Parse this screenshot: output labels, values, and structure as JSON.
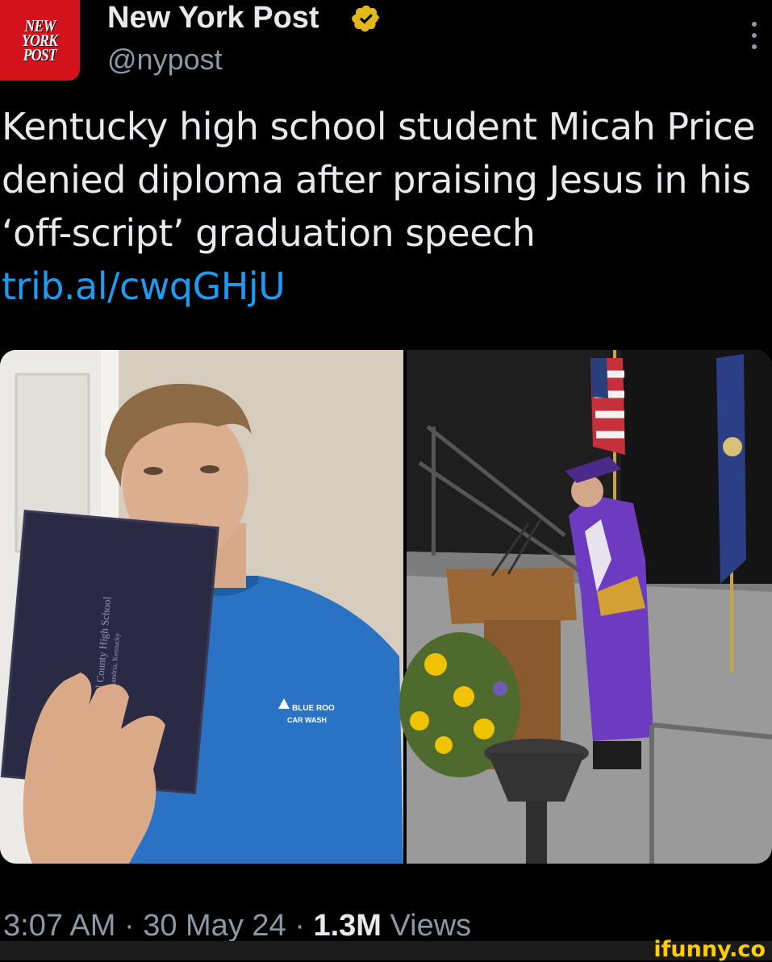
{
  "account": {
    "logo_lines": [
      "NEW",
      "YORK",
      "POST"
    ],
    "display_name": "New York Post",
    "handle": "@nypost",
    "badge_color": "#e2b719"
  },
  "tweet": {
    "text": "Kentucky high school student Micah Price denied diploma after praising Jesus in his ‘off-script’ graduation speech ",
    "link": "trib.al/cwqGHjU"
  },
  "media": {
    "diploma_lines": [
      "Al County High School",
      "Alexandria, Kentucky"
    ],
    "shirt_lines": [
      "BLUE ROO",
      "CAR WASH"
    ]
  },
  "meta": {
    "time": "3:07 AM",
    "separator": "·",
    "date": "30 May 24",
    "views_count": "1.3M",
    "views_label": "Views"
  },
  "watermark": "ifunny.co",
  "colors": {
    "link": "#1d9bf0",
    "secondary": "#8b98a5",
    "brand_red": "#d4121b"
  }
}
